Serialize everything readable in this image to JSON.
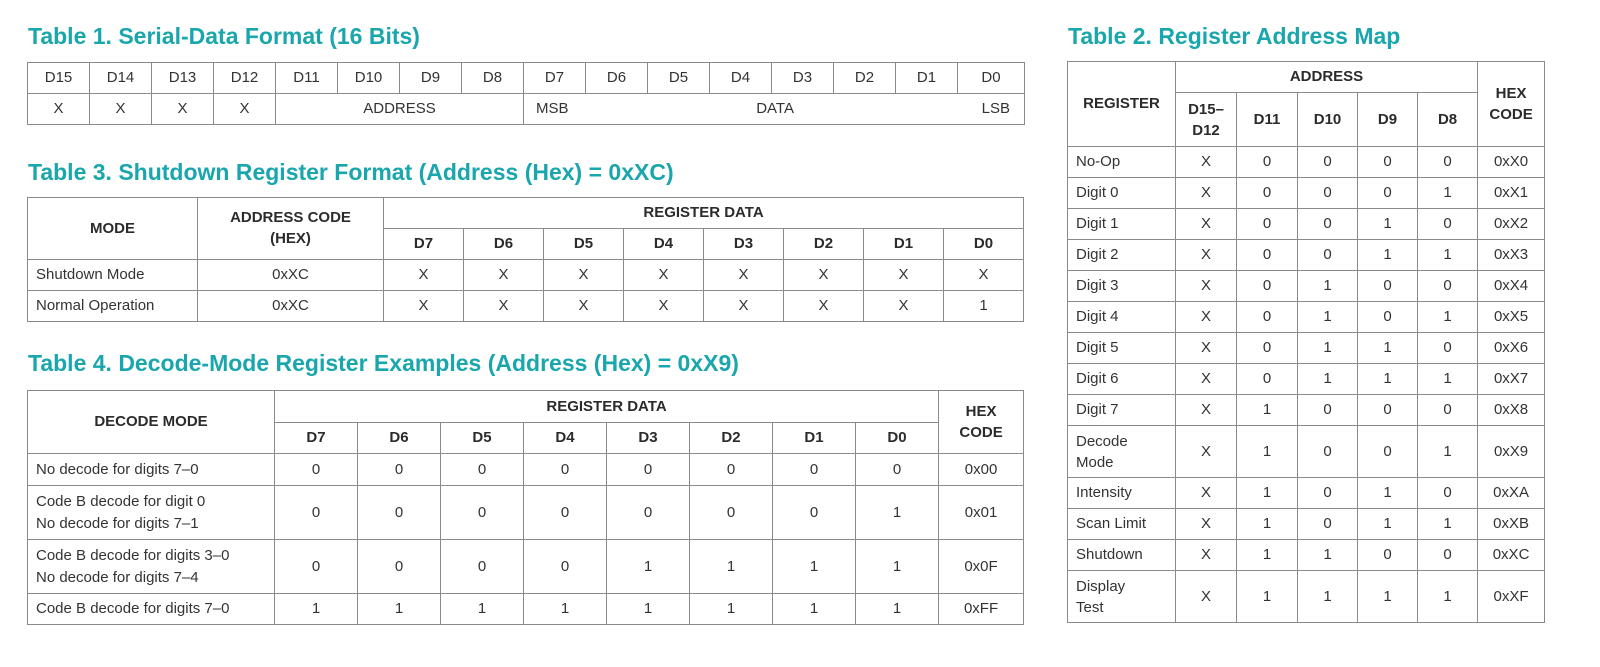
{
  "table1": {
    "title": "Table 1. Serial-Data Format (16 Bits)",
    "bits": [
      "D15",
      "D14",
      "D13",
      "D12",
      "D11",
      "D10",
      "D9",
      "D8",
      "D7",
      "D6",
      "D5",
      "D4",
      "D3",
      "D2",
      "D1",
      "D0"
    ],
    "row": {
      "x_cells": [
        "X",
        "X",
        "X",
        "X"
      ],
      "address": "ADDRESS",
      "msb": "MSB",
      "data": "DATA",
      "lsb": "LSB"
    }
  },
  "table2": {
    "title": "Table 2. Register Address Map",
    "headers": {
      "register": "REGISTER",
      "address": "ADDRESS",
      "hex_code": "HEX CODE",
      "cols": [
        "D15–D12",
        "D11",
        "D10",
        "D9",
        "D8"
      ]
    },
    "rows": [
      {
        "name": "No-Op",
        "cells": [
          "X",
          "0",
          "0",
          "0",
          "0"
        ],
        "hex": "0xX0"
      },
      {
        "name": "Digit 0",
        "cells": [
          "X",
          "0",
          "0",
          "0",
          "1"
        ],
        "hex": "0xX1"
      },
      {
        "name": "Digit 1",
        "cells": [
          "X",
          "0",
          "0",
          "1",
          "0"
        ],
        "hex": "0xX2"
      },
      {
        "name": "Digit 2",
        "cells": [
          "X",
          "0",
          "0",
          "1",
          "1"
        ],
        "hex": "0xX3"
      },
      {
        "name": "Digit 3",
        "cells": [
          "X",
          "0",
          "1",
          "0",
          "0"
        ],
        "hex": "0xX4"
      },
      {
        "name": "Digit 4",
        "cells": [
          "X",
          "0",
          "1",
          "0",
          "1"
        ],
        "hex": "0xX5"
      },
      {
        "name": "Digit 5",
        "cells": [
          "X",
          "0",
          "1",
          "1",
          "0"
        ],
        "hex": "0xX6"
      },
      {
        "name": "Digit 6",
        "cells": [
          "X",
          "0",
          "1",
          "1",
          "1"
        ],
        "hex": "0xX7"
      },
      {
        "name": "Digit 7",
        "cells": [
          "X",
          "1",
          "0",
          "0",
          "0"
        ],
        "hex": "0xX8"
      },
      {
        "name": "Decode Mode",
        "cells": [
          "X",
          "1",
          "0",
          "0",
          "1"
        ],
        "hex": "0xX9"
      },
      {
        "name": "Intensity",
        "cells": [
          "X",
          "1",
          "0",
          "1",
          "0"
        ],
        "hex": "0xXA"
      },
      {
        "name": "Scan Limit",
        "cells": [
          "X",
          "1",
          "0",
          "1",
          "1"
        ],
        "hex": "0xXB"
      },
      {
        "name": "Shutdown",
        "cells": [
          "X",
          "1",
          "1",
          "0",
          "0"
        ],
        "hex": "0xXC"
      },
      {
        "name": "Display Test",
        "cells": [
          "X",
          "1",
          "1",
          "1",
          "1"
        ],
        "hex": "0xXF"
      }
    ]
  },
  "table3": {
    "title": "Table 3. Shutdown Register Format (Address (Hex) = 0xXC)",
    "headers": {
      "mode": "MODE",
      "address_code": "ADDRESS CODE (HEX)",
      "register_data": "REGISTER DATA",
      "bits": [
        "D7",
        "D6",
        "D5",
        "D4",
        "D3",
        "D2",
        "D1",
        "D0"
      ]
    },
    "rows": [
      {
        "mode": "Shutdown Mode",
        "addr": "0xXC",
        "bits": [
          "X",
          "X",
          "X",
          "X",
          "X",
          "X",
          "X",
          "X"
        ]
      },
      {
        "mode": "Normal Operation",
        "addr": "0xXC",
        "bits": [
          "X",
          "X",
          "X",
          "X",
          "X",
          "X",
          "X",
          "1"
        ]
      }
    ]
  },
  "table4": {
    "title": "Table 4. Decode-Mode Register Examples (Address (Hex) = 0xX9)",
    "headers": {
      "decode_mode": "DECODE MODE",
      "register_data": "REGISTER DATA",
      "hex_code": "HEX CODE",
      "bits": [
        "D7",
        "D6",
        "D5",
        "D4",
        "D3",
        "D2",
        "D1",
        "D0"
      ]
    },
    "rows": [
      {
        "line1": "No decode for digits 7–0",
        "line2": "",
        "bits": [
          "0",
          "0",
          "0",
          "0",
          "0",
          "0",
          "0",
          "0"
        ],
        "hex": "0x00"
      },
      {
        "line1": "Code B decode for digit 0",
        "line2": "No decode for digits 7–1",
        "bits": [
          "0",
          "0",
          "0",
          "0",
          "0",
          "0",
          "0",
          "1"
        ],
        "hex": "0x01"
      },
      {
        "line1": "Code B decode for digits 3–0",
        "line2": "No decode for digits 7–4",
        "bits": [
          "0",
          "0",
          "0",
          "0",
          "1",
          "1",
          "1",
          "1"
        ],
        "hex": "0x0F"
      },
      {
        "line1": "Code B decode for digits 7–0",
        "line2": "",
        "bits": [
          "1",
          "1",
          "1",
          "1",
          "1",
          "1",
          "1",
          "1"
        ],
        "hex": "0xFF"
      }
    ]
  }
}
